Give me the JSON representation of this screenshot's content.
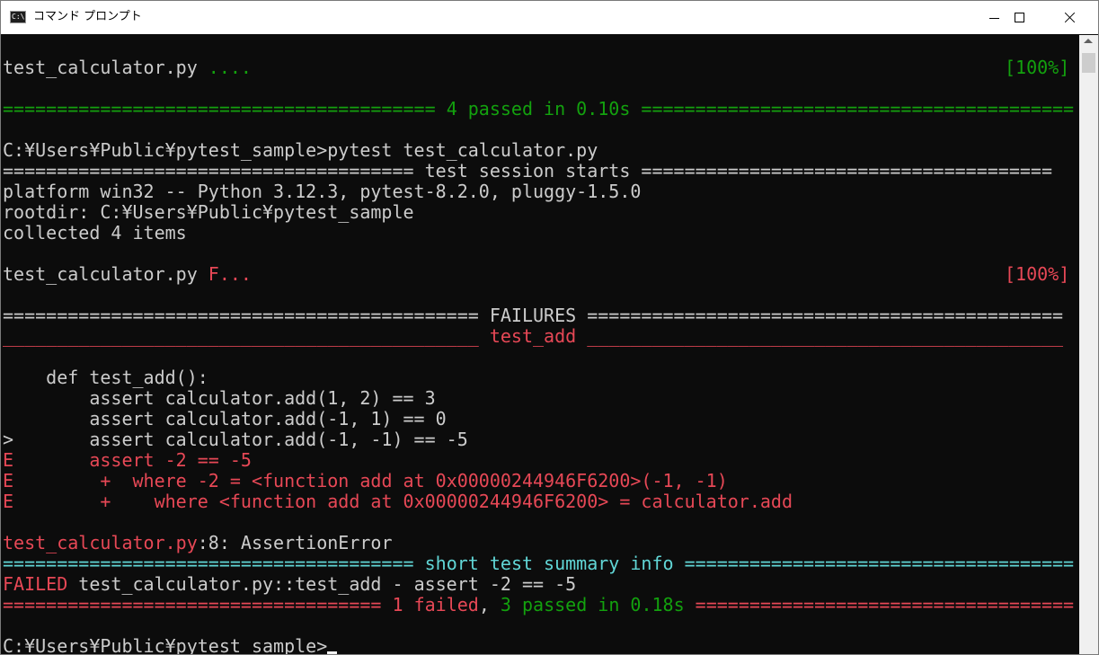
{
  "window": {
    "title": "コマンド プロンプト",
    "icon_label": "C:\\."
  },
  "colors": {
    "background": "#0c0c0c",
    "text": "#cccccc",
    "green": "#13a10e",
    "red": "#e74856",
    "cyan": "#61d6d6"
  },
  "run1": {
    "result_file": "test_calculator.py ",
    "result_dots": "....",
    "result_pct": "[100%]",
    "sep_left": "======================================== ",
    "summary": "4 passed in 0.10s",
    "sep_right": " ========================================"
  },
  "run2": {
    "command": "C:¥Users¥Public¥pytest_sample>pytest test_calculator.py",
    "session_header": "====================================== test session starts ======================================",
    "platform": "platform win32 -- Python 3.12.3, pytest-8.2.0, pluggy-1.5.0",
    "rootdir": "rootdir: C:¥Users¥Public¥pytest_sample",
    "collected": "collected 4 items",
    "result_file": "test_calculator.py ",
    "result_fail": "F",
    "result_dots": "...",
    "result_pct": "[100%]",
    "failures_header": "============================================ FAILURES ============================================",
    "test_header": "____________________________________________ test_add ____________________________________________",
    "code": [
      "    def test_add():",
      "        assert calculator.add(1, 2) == 3",
      "        assert calculator.add(-1, 1) == 0",
      ">       assert calculator.add(-1, -1) == -5"
    ],
    "errors": [
      {
        "marker": "E",
        "text": "       assert -2 == -5"
      },
      {
        "marker": "E",
        "text": "        +  where -2 = <function add at 0x00000244946F6200>(-1, -1)"
      },
      {
        "marker": "E",
        "text": "        +    where <function add at 0x00000244946F6200> = calculator.add"
      }
    ],
    "location_file": "test_calculator.py",
    "location_rest": ":8: AssertionError",
    "short_summary_left": "====================================== ",
    "short_summary_title": "short test summary info",
    "short_summary_right": " ====================================",
    "failed_label": "FAILED",
    "failed_detail": " test_calculator.py::test_add - assert -2 == -5",
    "final_left": "=================================== ",
    "final_failed": "1 failed",
    "final_comma": ", ",
    "final_passed": "3 passed in 0.18s",
    "final_right": " ==================================="
  },
  "prompt": "C:¥Users¥Public¥pytest_sample>"
}
